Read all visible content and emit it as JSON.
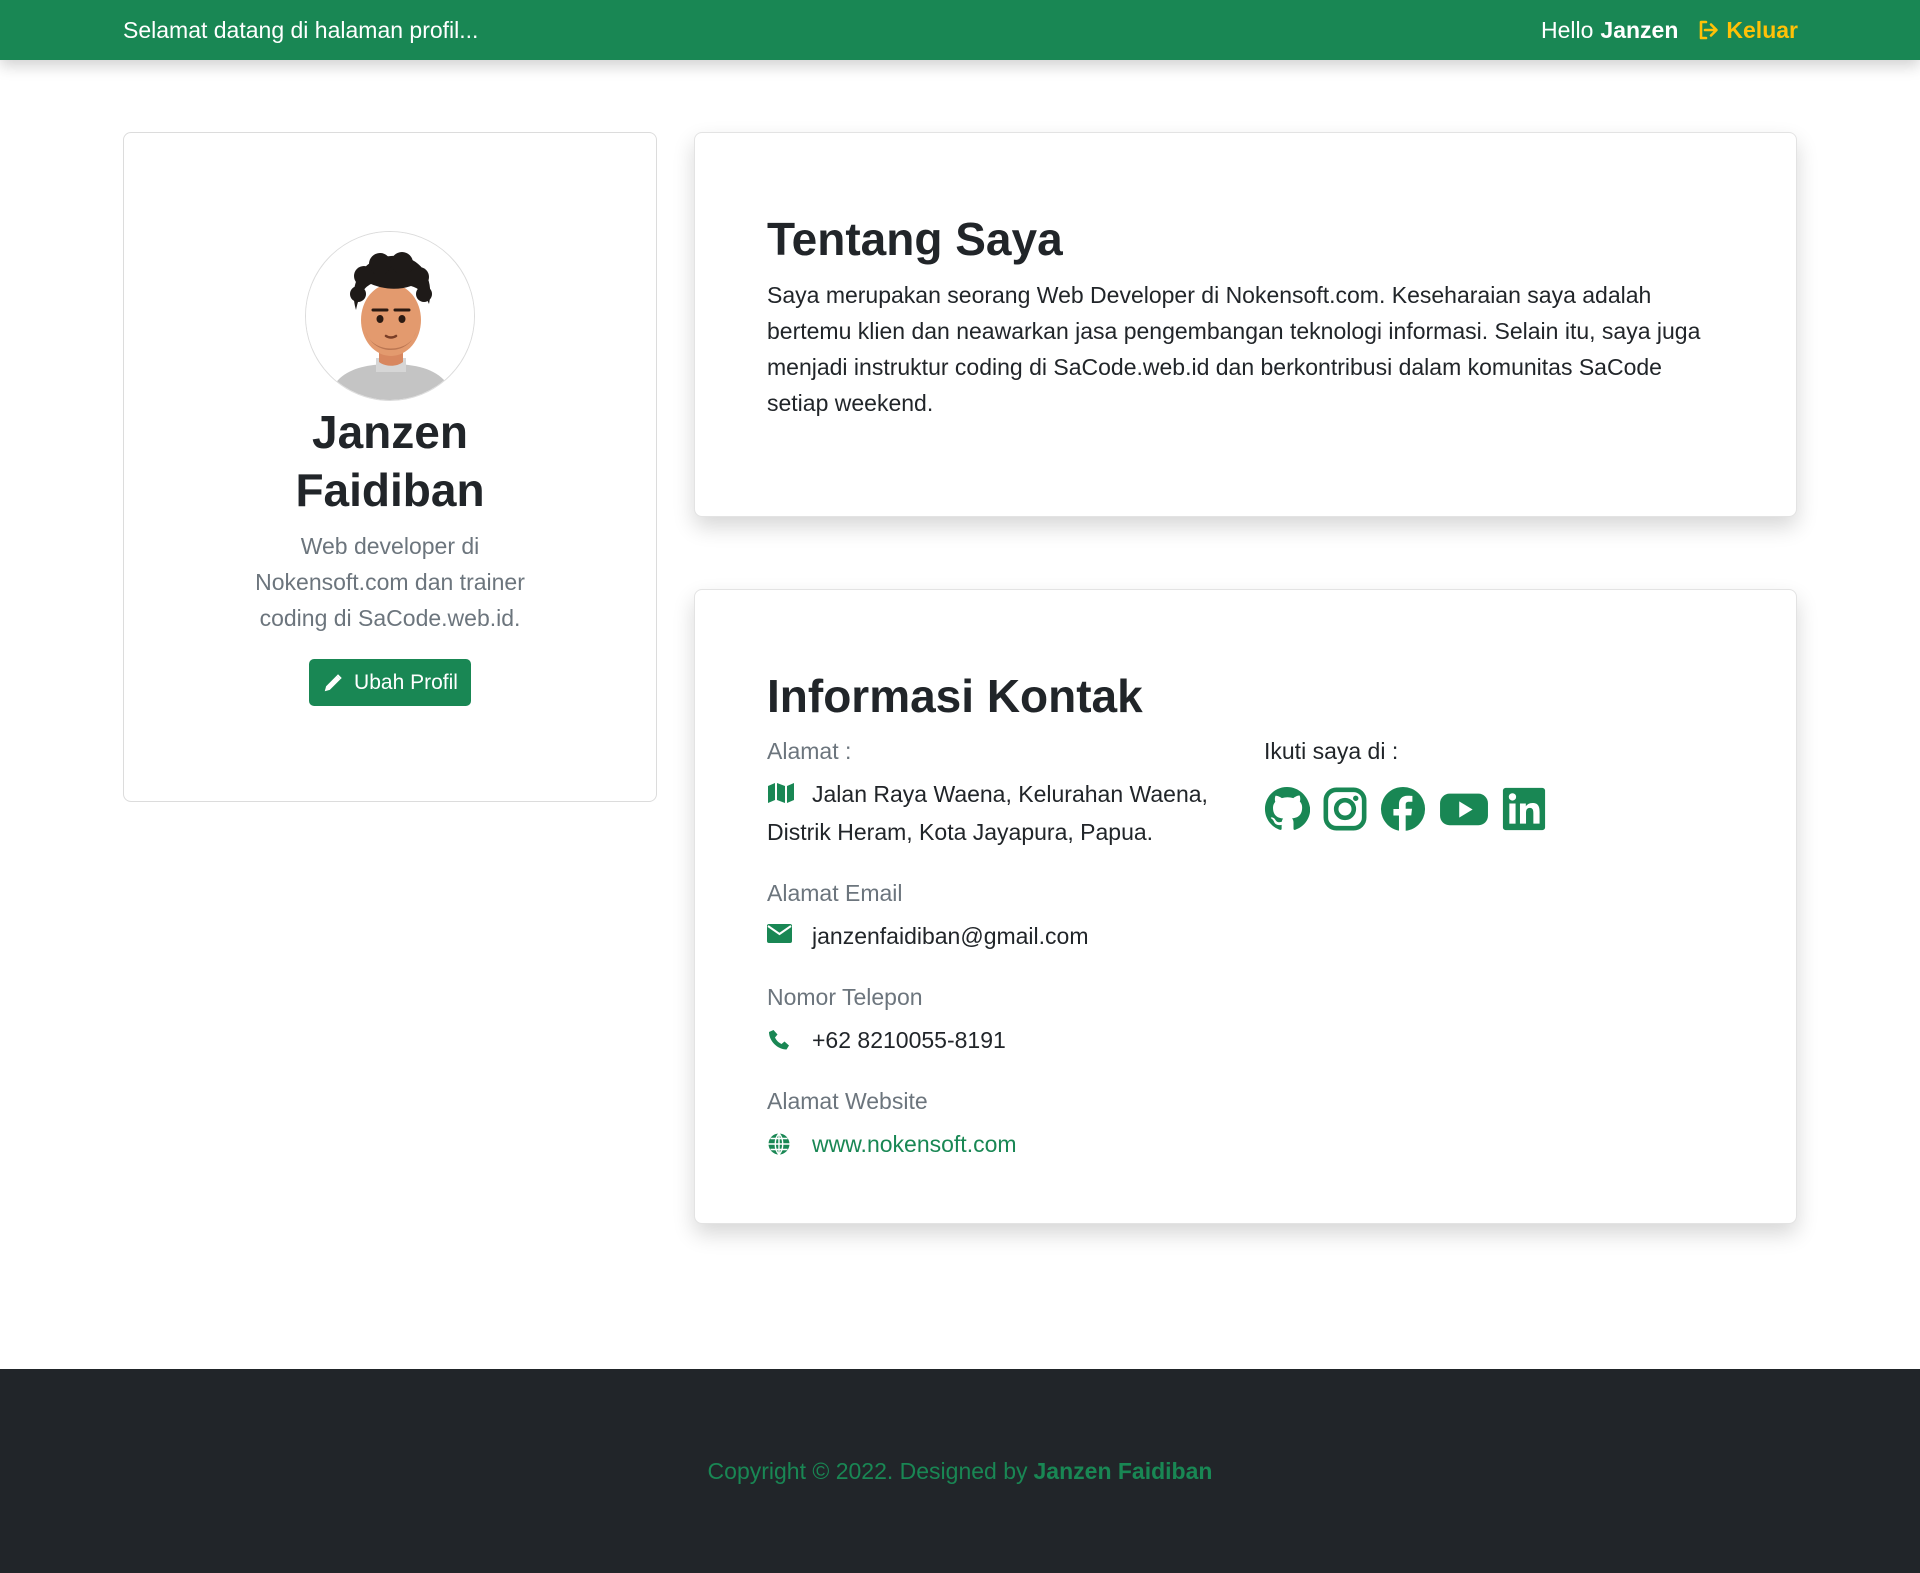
{
  "navbar": {
    "welcome": "Selamat datang di halaman profil...",
    "greeting": "Hello",
    "username": "Janzen",
    "logout_label": "Keluar"
  },
  "profile": {
    "avatar_icon": "person-avatar",
    "name": "Janzen Faidiban",
    "description": "Web developer di Nokensoft.com dan trainer coding di SaCode.web.id.",
    "edit_button": "Ubah Profil"
  },
  "about": {
    "title": "Tentang Saya",
    "text": "Saya merupakan seorang Web Developer di Nokensoft.com. Keseharaian saya adalah bertemu klien dan neawarkan jasa pengembangan teknologi informasi. Selain itu, saya juga menjadi instruktur coding di SaCode.web.id dan berkontribusi dalam komunitas SaCode setiap weekend."
  },
  "contact": {
    "title": "Informasi Kontak",
    "address_label": "Alamat :",
    "address": "Jalan Raya Waena, Kelurahan Waena, Distrik Heram, Kota Jayapura, Papua.",
    "email_label": "Alamat Email",
    "email": "janzenfaidiban@gmail.com",
    "phone_label": "Nomor Telepon",
    "phone": "+62 8210055-8191",
    "website_label": "Alamat Website",
    "website": "www.nokensoft.com",
    "follow_label": "Ikuti saya di :",
    "socials": [
      "github-icon",
      "instagram-icon",
      "facebook-icon",
      "youtube-icon",
      "linkedin-icon"
    ]
  },
  "footer": {
    "text": "Copyright © 2022. Designed by",
    "author": "Janzen Faidiban"
  },
  "colors": {
    "primary": "#198754",
    "warning": "#ffc107",
    "footer_bg": "#212529",
    "muted": "#6c757d"
  }
}
